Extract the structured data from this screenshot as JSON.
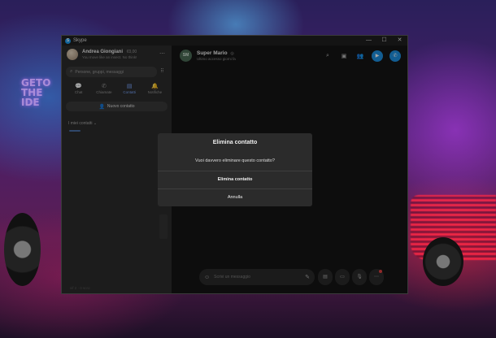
{
  "window": {
    "title": "Skype",
    "controls": [
      "—",
      "☐",
      "✕"
    ]
  },
  "sidebar": {
    "profile": {
      "name": "Andrea Giongiani",
      "amount": "€0,00",
      "status": "You move like an insect. No think!"
    },
    "more_icon": "⋯",
    "search": {
      "placeholder": "Persone, gruppi, messaggi",
      "icon": "⌕"
    },
    "dial_icon": "⠿",
    "tabs": [
      {
        "label": "Chat",
        "icon": "💬"
      },
      {
        "label": "Chiamate",
        "icon": "✆"
      },
      {
        "label": "Contatti",
        "icon": "▤"
      },
      {
        "label": "Notifiche",
        "icon": "🔔"
      }
    ],
    "new_contact": {
      "label": "Nuovo contatto",
      "icon": "👤"
    },
    "contacts_heading": "I miei contatti ⌄",
    "footer_text": "vif 2 · 0 scro"
  },
  "chat": {
    "contact": {
      "initials": "SM",
      "name": "Super Mario",
      "verified": "◎",
      "last_seen": "Ultimo accesso giorni fa"
    },
    "actions": [
      "⌕",
      "▣",
      "👥",
      "▶",
      "✆"
    ],
    "composer": {
      "emoji_icon": "☺",
      "placeholder": "Scrivi un messaggio",
      "attach_icon": "✎"
    },
    "tools": [
      "▤",
      "▭",
      "🎙",
      "⋯"
    ]
  },
  "dialog": {
    "title": "Elimina contatto",
    "question": "Vuoi davvero eliminare questo contatto?",
    "confirm": "Elimina contatto",
    "cancel": "Annulla"
  },
  "wallpaper": {
    "text": "GETO\nTHE\nIDE"
  },
  "colors": {
    "accent": "#1d8fe0",
    "window_bg": "#1f1f1f",
    "sidebar_bg": "#2b2b2b",
    "chat_bg": "#141414",
    "dialog_bg": "#2b2b2b"
  }
}
